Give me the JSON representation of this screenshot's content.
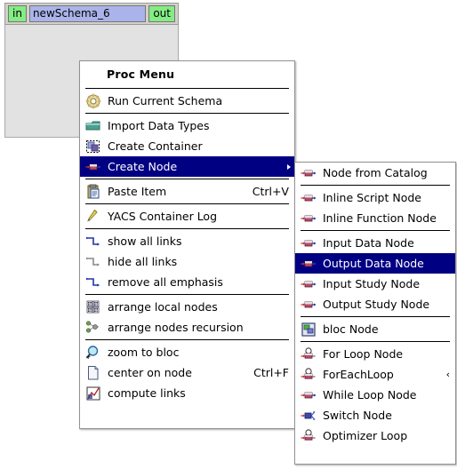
{
  "canvas": {
    "node": {
      "in_port": "in",
      "title": "newSchema_6",
      "out_port": "out"
    }
  },
  "proc_menu": {
    "title": "Proc Menu",
    "items": [
      {
        "label": "Run Current Schema",
        "icon": "gear-icon",
        "accel": "",
        "sep_after": true
      },
      {
        "label": "Import Data Types",
        "icon": "folder-icon",
        "accel": "",
        "sep_after": false
      },
      {
        "label": "Create Container",
        "icon": "container-icon",
        "accel": "",
        "sep_after": false
      },
      {
        "label": "Create Node",
        "icon": "node-icon",
        "accel": "",
        "highlighted": true,
        "submenu": true,
        "sep_after": true
      },
      {
        "label": "Paste Item",
        "icon": "paste-icon",
        "accel": "Ctrl+V",
        "sep_after": true
      },
      {
        "label": "YACS Container Log",
        "icon": "log-icon",
        "accel": "",
        "sep_after": true
      },
      {
        "label": "show all links",
        "icon": "show-links-icon",
        "accel": "",
        "sep_after": false
      },
      {
        "label": "hide all links",
        "icon": "hide-links-icon",
        "accel": "",
        "sep_after": false
      },
      {
        "label": "remove all emphasis",
        "icon": "remove-emphasis-icon",
        "accel": "",
        "sep_after": true
      },
      {
        "label": "arrange local nodes",
        "icon": "arrange-local-icon",
        "accel": "",
        "sep_after": false
      },
      {
        "label": "arrange nodes recursion",
        "icon": "arrange-recursion-icon",
        "accel": "",
        "sep_after": true
      },
      {
        "label": "zoom to bloc",
        "icon": "zoom-icon",
        "accel": "",
        "sep_after": false
      },
      {
        "label": "center on node",
        "icon": "page-icon",
        "accel": "Ctrl+F",
        "sep_after": false
      },
      {
        "label": "compute links",
        "icon": "compute-links-icon",
        "accel": "",
        "sep_after": false
      }
    ]
  },
  "node_submenu": {
    "items": [
      {
        "label": "Node from Catalog",
        "icon": "node-icon",
        "sep_after": true
      },
      {
        "label": "Inline Script Node",
        "icon": "node-icon",
        "sep_after": false
      },
      {
        "label": "Inline Function Node",
        "icon": "node-icon",
        "sep_after": true
      },
      {
        "label": "Input Data Node",
        "icon": "node-icon",
        "sep_after": false
      },
      {
        "label": "Output Data Node",
        "icon": "node-icon",
        "highlighted": true,
        "sep_after": false
      },
      {
        "label": "Input Study Node",
        "icon": "node-icon",
        "sep_after": false
      },
      {
        "label": "Output Study Node",
        "icon": "node-icon",
        "sep_after": true
      },
      {
        "label": "bloc Node",
        "icon": "bloc-icon",
        "sep_after": true
      },
      {
        "label": "For Loop Node",
        "icon": "loop-icon",
        "sep_after": false
      },
      {
        "label": "ForEachLoop",
        "icon": "loop-icon",
        "arrow": "‹",
        "submenu": true,
        "sep_after": false
      },
      {
        "label": "While Loop Node",
        "icon": "node-icon",
        "sep_after": false
      },
      {
        "label": "Switch Node",
        "icon": "switch-icon",
        "sep_after": false
      },
      {
        "label": "Optimizer Loop",
        "icon": "loop-icon",
        "sep_after": false
      }
    ]
  },
  "colors": {
    "highlight": "#000082",
    "highlight_text": "#ffffff",
    "menu_bg": "#ffffff",
    "canvas_panel": "#e2e2e2",
    "port_green": "#84ec84",
    "node_blue": "#aab4ea"
  }
}
